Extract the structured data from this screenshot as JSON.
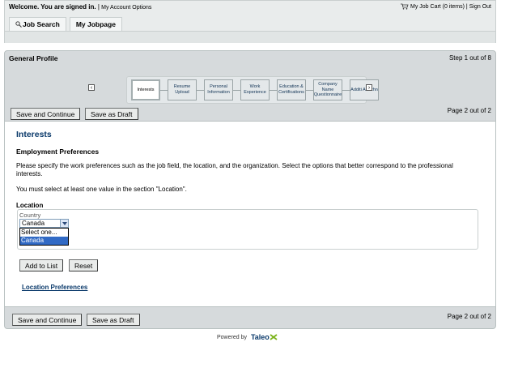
{
  "header": {
    "welcome": "Welcome. You are signed in.",
    "separator": "|",
    "account_link": "My Account Options",
    "job_cart": "My Job Cart (0 items)",
    "sign_out": "Sign Out"
  },
  "tabs": [
    {
      "label": "Job Search",
      "icon": "magnifier-icon"
    },
    {
      "label": "My Jobpage"
    }
  ],
  "profile": {
    "title": "General Profile",
    "step": "Step 1 out of 8",
    "steps": [
      {
        "label": "Interests",
        "active": true
      },
      {
        "label": "Resume Upload"
      },
      {
        "label": "Personal Information"
      },
      {
        "label": "Work Experience"
      },
      {
        "label": "Education & Certifications"
      },
      {
        "label": "Company Name Questionnaire"
      },
      {
        "label": "Additi Attachn"
      }
    ],
    "prev_arrow": "‹",
    "next_arrow": "›"
  },
  "toolbar": {
    "save_continue": "Save and Continue",
    "save_draft": "Save as Draft",
    "page_info": "Page 2 out of 2"
  },
  "content": {
    "heading": "Interests",
    "subheading": "Employment Preferences",
    "para1": "Please specify the work preferences such as the job field, the location, and the organization. Select the options that better correspond to the professional interests.",
    "para2": "You must select at least one value in the section \"Location\".",
    "location_label": "Location",
    "country_label": "Country",
    "country_value": "Canada",
    "country_options": [
      "Select one...",
      "Canada"
    ],
    "selected_option_index": 1,
    "add_to_list": "Add to List",
    "reset": "Reset",
    "location_preferences_link": "Location Preferences"
  },
  "footer": {
    "powered_by": "Powered by",
    "brand": "Taleo",
    "brand_color": "#0b3a6b",
    "accent_color": "#7bb31a"
  }
}
